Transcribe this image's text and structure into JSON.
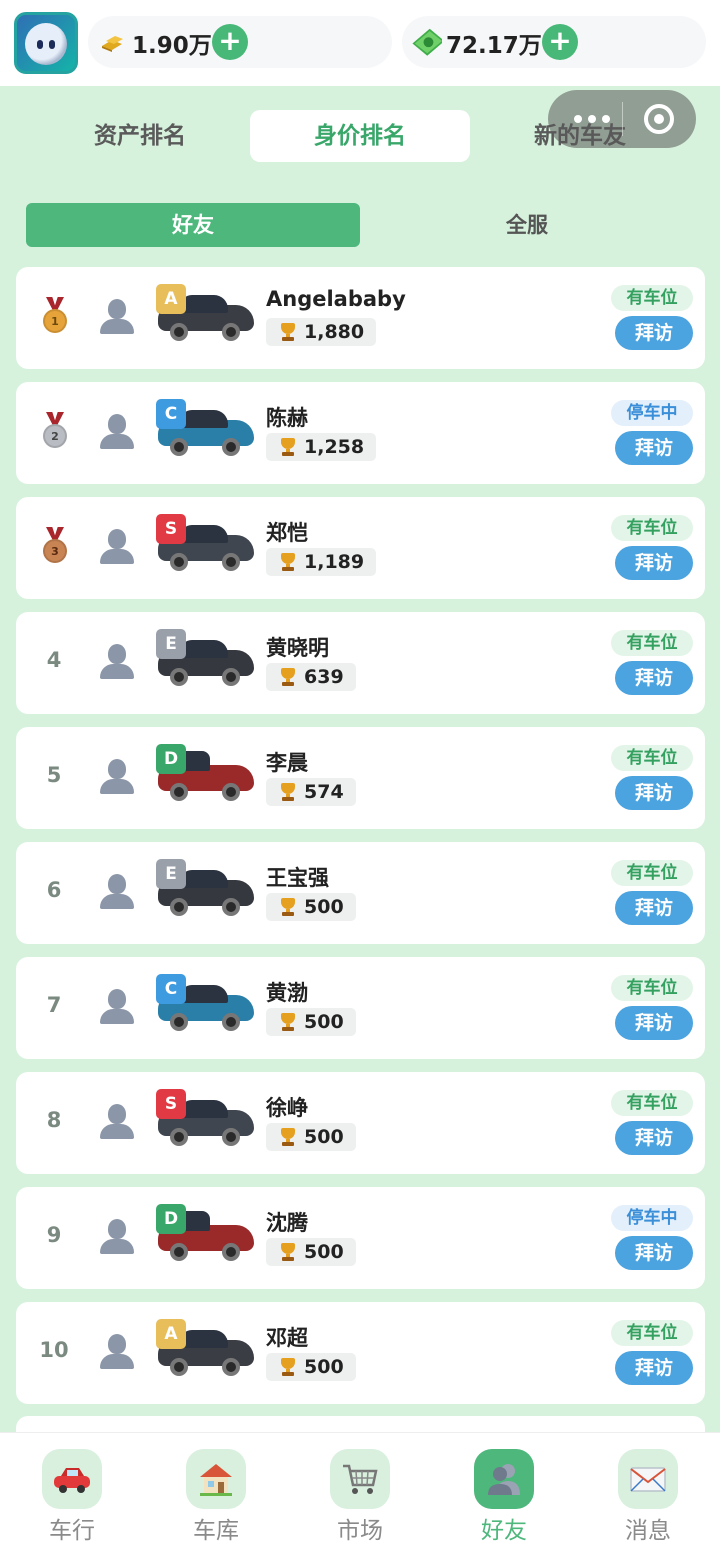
{
  "header": {
    "gold_value": "1.90万",
    "cash_value": "72.17万",
    "gold_icon": "gold-bars-icon",
    "cash_icon": "cash-icon",
    "add_label": "+"
  },
  "tabs": [
    "资产排名",
    "身价排名",
    "新的车友"
  ],
  "subtabs": [
    "好友",
    "全服"
  ],
  "colors": {
    "accent_green": "#4db77c",
    "visit_blue": "#4ba3df",
    "grade_A": "#e8be5a",
    "grade_C": "#3e9be0",
    "grade_S": "#e23a45",
    "grade_E": "#9aa0aa",
    "grade_D": "#3aa76a"
  },
  "rows": [
    {
      "rank": "1",
      "medal": "gold",
      "grade": "A",
      "car_color": "#3a3d44",
      "name": "Angelababy",
      "score": "1,880",
      "status": "有车位",
      "status_kind": "free",
      "action": "拜访"
    },
    {
      "rank": "2",
      "medal": "silver",
      "grade": "C",
      "car_color": "#2a7fa8",
      "name": "陈赫",
      "score": "1,258",
      "status": "停车中",
      "status_kind": "busy",
      "action": "拜访"
    },
    {
      "rank": "3",
      "medal": "bronze",
      "grade": "S",
      "car_color": "#40464f",
      "name": "郑恺",
      "score": "1,189",
      "status": "有车位",
      "status_kind": "free",
      "action": "拜访"
    },
    {
      "rank": "4",
      "medal": "",
      "grade": "E",
      "car_color": "#35383e",
      "name": "黄晓明",
      "score": "639",
      "status": "有车位",
      "status_kind": "free",
      "action": "拜访"
    },
    {
      "rank": "5",
      "medal": "",
      "grade": "D",
      "car_color": "#9a2a2a",
      "name": "李晨",
      "score": "574",
      "status": "有车位",
      "status_kind": "free",
      "action": "拜访"
    },
    {
      "rank": "6",
      "medal": "",
      "grade": "E",
      "car_color": "#35383e",
      "name": "王宝强",
      "score": "500",
      "status": "有车位",
      "status_kind": "free",
      "action": "拜访"
    },
    {
      "rank": "7",
      "medal": "",
      "grade": "C",
      "car_color": "#2a7fa8",
      "name": "黄渤",
      "score": "500",
      "status": "有车位",
      "status_kind": "free",
      "action": "拜访"
    },
    {
      "rank": "8",
      "medal": "",
      "grade": "S",
      "car_color": "#40464f",
      "name": "徐峥",
      "score": "500",
      "status": "有车位",
      "status_kind": "free",
      "action": "拜访"
    },
    {
      "rank": "9",
      "medal": "",
      "grade": "D",
      "car_color": "#9a2a2a",
      "name": "沈腾",
      "score": "500",
      "status": "停车中",
      "status_kind": "busy",
      "action": "拜访"
    },
    {
      "rank": "10",
      "medal": "",
      "grade": "A",
      "car_color": "#3a3d44",
      "name": "邓超",
      "score": "500",
      "status": "有车位",
      "status_kind": "free",
      "action": "拜访"
    }
  ],
  "nav": [
    {
      "label": "车行",
      "icon": "car-icon"
    },
    {
      "label": "车库",
      "icon": "house-icon"
    },
    {
      "label": "市场",
      "icon": "cart-icon"
    },
    {
      "label": "好友",
      "icon": "friends-icon"
    },
    {
      "label": "消息",
      "icon": "mail-icon"
    }
  ]
}
